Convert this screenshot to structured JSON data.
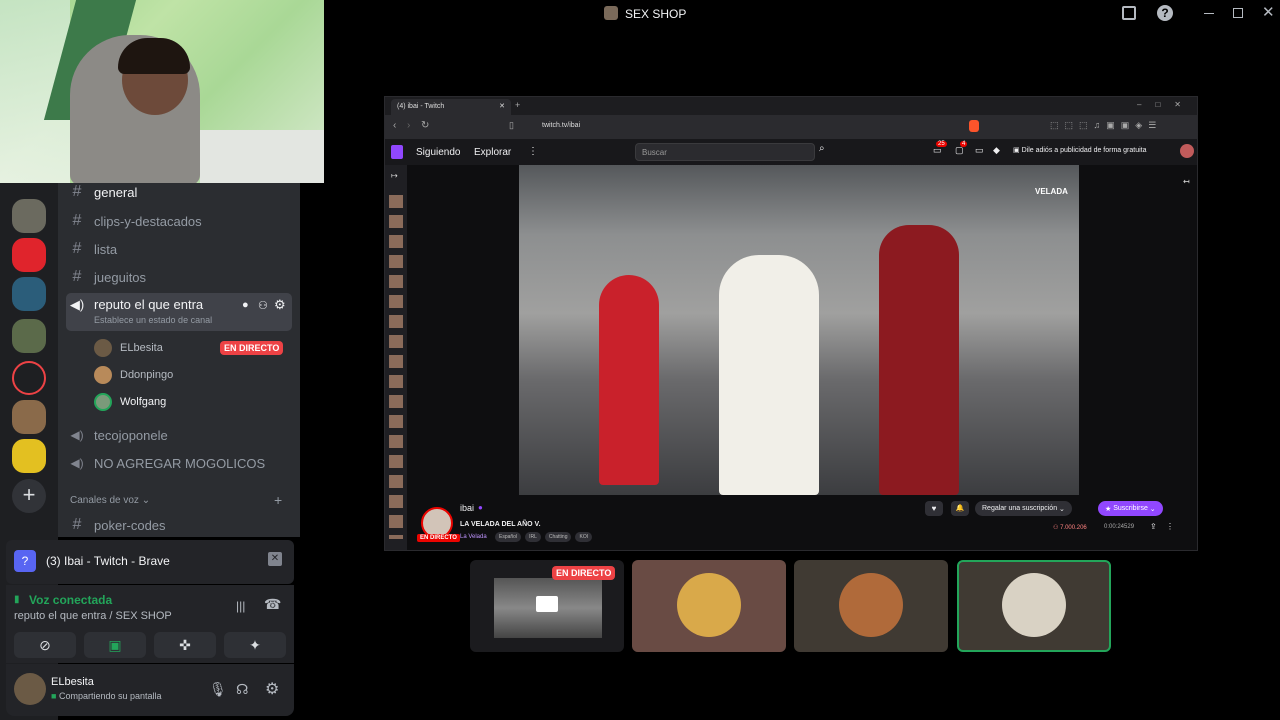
{
  "window": {
    "title": "SEX SHOP"
  },
  "channels": {
    "items": [
      {
        "label": "general",
        "type": "text"
      },
      {
        "label": "clips-y-destacados",
        "type": "text"
      },
      {
        "label": "lista",
        "type": "text"
      },
      {
        "label": "jueguitos",
        "type": "text"
      }
    ],
    "voice_active": {
      "label": "reputo el que entra",
      "status_prompt": "Establece un estado de canal",
      "users": [
        {
          "name": "ELbesita",
          "badge": "EN DIRECTO"
        },
        {
          "name": "Ddonpingo",
          "badge": ""
        },
        {
          "name": "Wolfgang",
          "badge": ""
        }
      ]
    },
    "voice_other": [
      {
        "label": "tecojoponele"
      },
      {
        "label": "NO AGREGAR MOGOLICOS"
      }
    ],
    "category_label": "Canales de voz",
    "after_category": [
      {
        "label": "poker-codes"
      }
    ]
  },
  "share_card": {
    "title": "(3) Ibai - Twitch - Brave"
  },
  "voice_panel": {
    "status": "Voz conectada",
    "location": "reputo el que entra / SEX SHOP"
  },
  "user_panel": {
    "name": "ELbesita",
    "status": "Compartiendo su pantalla"
  },
  "browser": {
    "tab_title": "(4) ibai - Twitch",
    "url": "twitch.tv/ibai",
    "nav": {
      "following": "Siguiendo",
      "explore": "Explorar",
      "search_placeholder": "Buscar",
      "notif_count": "25",
      "inbox_count": "4",
      "ad_free": "Dile adiós a publicidad de forma gratuita"
    },
    "stream": {
      "streamer": "ibai",
      "title": "LA VELADA DEL AÑO V.",
      "live_badge": "EN DIRECTO",
      "category": "La Velada",
      "tags": [
        "Español",
        "IRL",
        "Chatting",
        "KOI"
      ],
      "gift_label": "Regalar una suscripción",
      "subscribe_label": "Suscribirse",
      "viewers": "7.000.206",
      "uptime": "0:00:24529",
      "overlay_logo": "VELADA"
    }
  },
  "stream_tiles": [
    {
      "name": "screen-share",
      "badge": "EN DIRECTO"
    },
    {
      "name": "user-2",
      "badge": ""
    },
    {
      "name": "user-3",
      "badge": ""
    },
    {
      "name": "user-4",
      "badge": ""
    }
  ],
  "colors": {
    "accent_green": "#23a55a",
    "live_red": "#ed4245",
    "twitch_purple": "#9147ff",
    "discord_bg": "#2b2d31"
  }
}
